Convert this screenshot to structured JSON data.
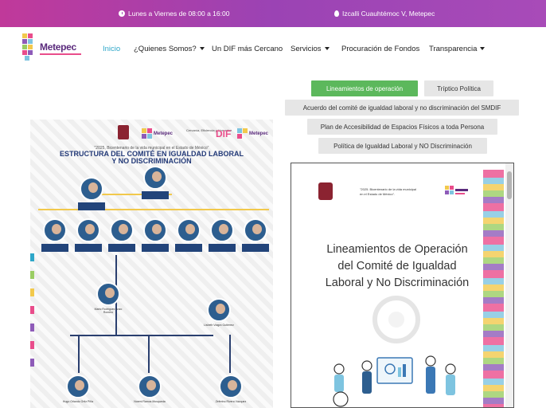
{
  "topbar": {
    "hours": "Lunes a Viernes de 08:00 a 16:00",
    "address": "Izcalli Cuauhtémoc V, Metepec",
    "icons": [
      "clock-icon",
      "map-pin-icon"
    ]
  },
  "brand": {
    "name": "Metepec"
  },
  "nav": {
    "items": [
      {
        "label": "Inicio",
        "active": true,
        "dropdown": false
      },
      {
        "label": "¿Quienes Somos?",
        "active": false,
        "dropdown": true
      },
      {
        "label": "Un DIF más Cercano",
        "active": false,
        "dropdown": false
      },
      {
        "label": "Servicios",
        "active": false,
        "dropdown": true
      },
      {
        "label": "Procuración de Fondos",
        "active": false,
        "dropdown": false
      },
      {
        "label": "Transparencia",
        "active": false,
        "dropdown": true
      }
    ]
  },
  "org_chart": {
    "motto": "\"2025, Bicentenario de la vida municipal en el Estado de México\"",
    "title_line1": "ESTRUCTURA DEL COMITÉ EN IGUALDAD LABORAL",
    "title_line2": "Y NO DISCRIMINACIÓN",
    "logo_text_1": "Metepec",
    "logo_text_2": "Cercanía, Eficiencia y Honradez",
    "logo_text_3": "DIF",
    "logo_text_4": "Metepec",
    "named_members": [
      "Mario Rodríguez Anzo Romero",
      "Lisbeth Viagra Gutiérrez",
      "Hugo Orlando Ortiz Piña",
      "Noemi Ramos Mosqueda",
      "Zeferino Rivera Vázquez"
    ]
  },
  "docs": {
    "buttons": [
      {
        "label": "Lineamientos de operación",
        "active": true
      },
      {
        "label": "Tríptico Política",
        "active": false
      },
      {
        "label": "Acuerdo del comité de igualdad laboral y no discriminación del SMDIF",
        "active": false
      },
      {
        "label": "Plan de Accesibilidad de Espacios Físicos a toda Persona",
        "active": false
      },
      {
        "label": "Política de Igualdad Laboral y NO Discriminación",
        "active": false
      }
    ]
  },
  "viewer": {
    "header_note_1": "\"2025. Bicentenario de la vida municipal",
    "header_note_2": "en el Estado de México\".",
    "title_line1": "Lineamientos de Operación",
    "title_line2": "del Comité de Igualdad",
    "title_line3": "Laboral y No Discriminación"
  },
  "colors": {
    "topbar_start": "#c0399a",
    "topbar_end": "#a84bb8",
    "nav_active": "#2ea7c9",
    "button_active": "#5cb85c",
    "button_inactive": "#e6e6e6",
    "org_title": "#233a78"
  }
}
